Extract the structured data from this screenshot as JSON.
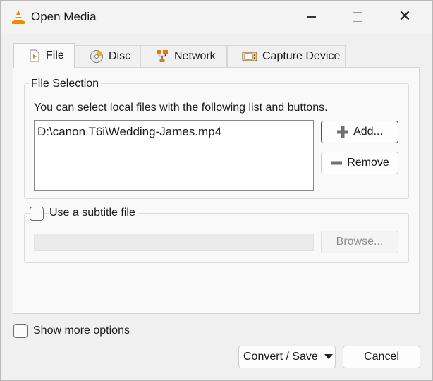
{
  "window": {
    "title": "Open Media"
  },
  "tabs": [
    {
      "label": "File",
      "icon": "file-play-icon",
      "active": true
    },
    {
      "label": "Disc",
      "icon": "disc-icon",
      "active": false
    },
    {
      "label": "Network",
      "icon": "network-icon",
      "active": false
    },
    {
      "label": "Capture Device",
      "icon": "capture-device-icon",
      "active": false
    }
  ],
  "file_selection": {
    "group_label": "File Selection",
    "hint": "You can select local files with the following list and buttons.",
    "files": [
      "D:\\canon T6i\\Wedding-James.mp4"
    ],
    "add_label": "Add...",
    "remove_label": "Remove"
  },
  "subtitle": {
    "checkbox_label": "Use a subtitle file",
    "checked": false,
    "path_value": "",
    "browse_label": "Browse..."
  },
  "options": {
    "show_more_label": "Show more options",
    "checked": false
  },
  "footer": {
    "convert_label": "Convert / Save",
    "cancel_label": "Cancel"
  },
  "colors": {
    "accent": "#0f62b5",
    "vlc_orange": "#f28a00"
  }
}
